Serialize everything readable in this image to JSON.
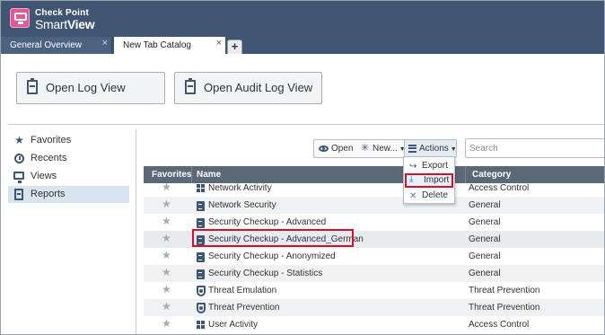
{
  "app": {
    "brand_line1": "Check Point",
    "brand_line2a": "Smart",
    "brand_line2b": "View",
    "logo_icon": "monitor-logo-icon",
    "header_color": "#3f5672"
  },
  "tabs": [
    {
      "label": "General Overview",
      "active": false
    },
    {
      "label": "New Tab Catalog",
      "active": true
    }
  ],
  "tab_close_glyph": "×",
  "tab_add_glyph": "+",
  "launch": {
    "open_log": "Open Log View",
    "open_audit": "Open Audit Log View"
  },
  "nav": [
    {
      "label": "Favorites",
      "icon": "star-icon",
      "active": false
    },
    {
      "label": "Recents",
      "icon": "clock-icon",
      "active": false
    },
    {
      "label": "Views",
      "icon": "monitor-icon",
      "active": false
    },
    {
      "label": "Reports",
      "icon": "report-icon",
      "active": true
    }
  ],
  "toolbar": {
    "open": "Open",
    "new": "New...",
    "actions": "Actions"
  },
  "search": {
    "placeholder": "Search"
  },
  "actions_menu": [
    {
      "label": "Export",
      "icon": "export-icon"
    },
    {
      "label": "Import",
      "icon": "import-icon",
      "highlighted": true
    },
    {
      "label": "Delete",
      "icon": "delete-icon"
    }
  ],
  "table": {
    "headers": {
      "favorites": "Favorites",
      "name": "Name",
      "category": "Category"
    },
    "rows": [
      {
        "name": "Network Activity",
        "category": "Access Control",
        "icon": "grid-icon"
      },
      {
        "name": "Network Security",
        "category": "General",
        "icon": "report-icon"
      },
      {
        "name": "Security Checkup - Advanced",
        "category": "General",
        "icon": "report-icon"
      },
      {
        "name": "Security Checkup - Advanced_German",
        "category": "General",
        "icon": "report-icon",
        "highlighted": true
      },
      {
        "name": "Security Checkup - Anonymized",
        "category": "General",
        "icon": "report-icon"
      },
      {
        "name": "Security Checkup - Statistics",
        "category": "General",
        "icon": "report-icon"
      },
      {
        "name": "Threat Emulation",
        "category": "Threat Prevention",
        "icon": "shield-icon"
      },
      {
        "name": "Threat Prevention",
        "category": "Threat Prevention",
        "icon": "shield-icon"
      },
      {
        "name": "User Activity",
        "category": "Access Control",
        "icon": "grid-icon"
      }
    ]
  },
  "colors": {
    "highlight_border": "#d4102c",
    "active_nav": "#d9e4f1",
    "table_header": "#5b6877"
  }
}
